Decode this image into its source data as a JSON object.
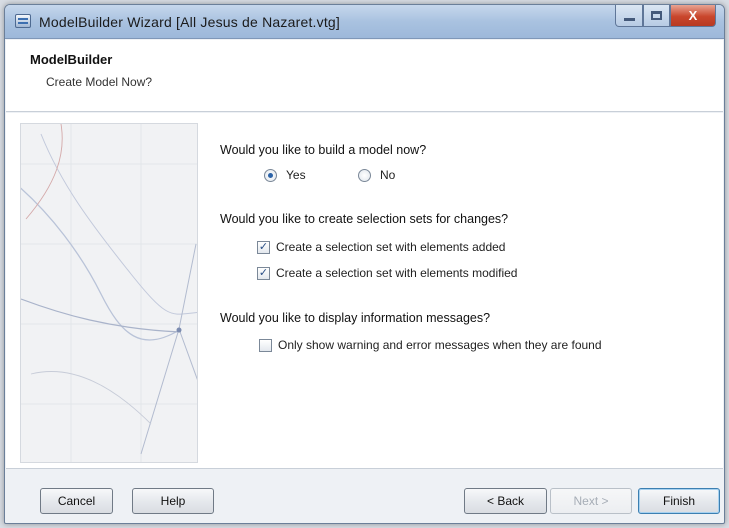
{
  "window": {
    "title": "ModelBuilder Wizard [All Jesus de Nazaret.vtg]",
    "controls": {
      "minimize_icon": "minimize-icon",
      "maximize_icon": "maximize-icon",
      "close_glyph": "X"
    }
  },
  "header": {
    "title": "ModelBuilder",
    "subtitle": "Create Model Now?"
  },
  "questions": [
    {
      "text": "Would you like to build a model now?",
      "type": "radio",
      "options": [
        {
          "label": "Yes",
          "selected": true
        },
        {
          "label": "No",
          "selected": false
        }
      ]
    },
    {
      "text": "Would you like to create selection sets for changes?",
      "type": "checkbox",
      "options": [
        {
          "label": "Create a selection set with elements added",
          "checked": true
        },
        {
          "label": "Create a selection set with elements modified",
          "checked": true
        }
      ]
    },
    {
      "text": "Would you like to display information messages?",
      "type": "checkbox",
      "options": [
        {
          "label": "Only show warning and error messages when they are found",
          "checked": false
        }
      ]
    }
  ],
  "footer": {
    "cancel": "Cancel",
    "help": "Help",
    "back": "< Back",
    "next": "Next >",
    "finish": "Finish"
  },
  "colors": {
    "window_border": "#6b7f99",
    "close_red": "#c9462c",
    "accent_blue": "#2c63a8"
  }
}
